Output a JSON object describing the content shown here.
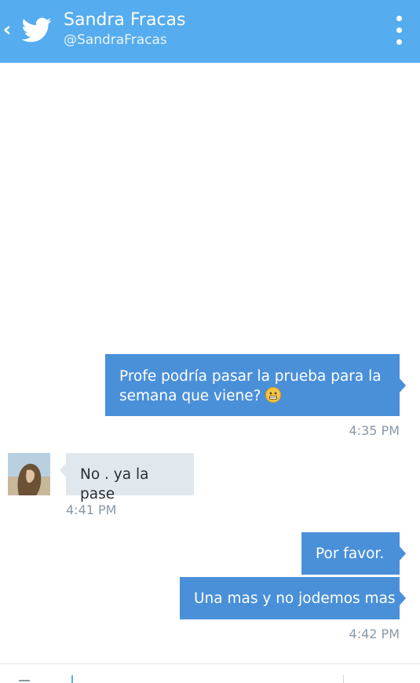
{
  "header": {
    "name": "Sandra Fracas",
    "handle": "@SandraFracas",
    "background": "#55acee"
  },
  "messages": [
    {
      "direction": "sent",
      "text": "Profe podría pasar la prueba para la semana que viene?",
      "emoji": "grimacing-face"
    },
    {
      "direction": "sent",
      "time": "4:35 PM"
    },
    {
      "direction": "received",
      "text": "No . ya la pase"
    },
    {
      "direction": "received",
      "time": "4:41 PM"
    },
    {
      "direction": "sent",
      "text": "Por favor."
    },
    {
      "direction": "sent",
      "text": "Una mas y no jodemos mas"
    },
    {
      "direction": "sent",
      "time": "4:42 PM"
    }
  ],
  "colors": {
    "sent_bubble": "#4a90d9",
    "received_bubble": "#e1e8ed",
    "timestamp": "#8899a6"
  }
}
